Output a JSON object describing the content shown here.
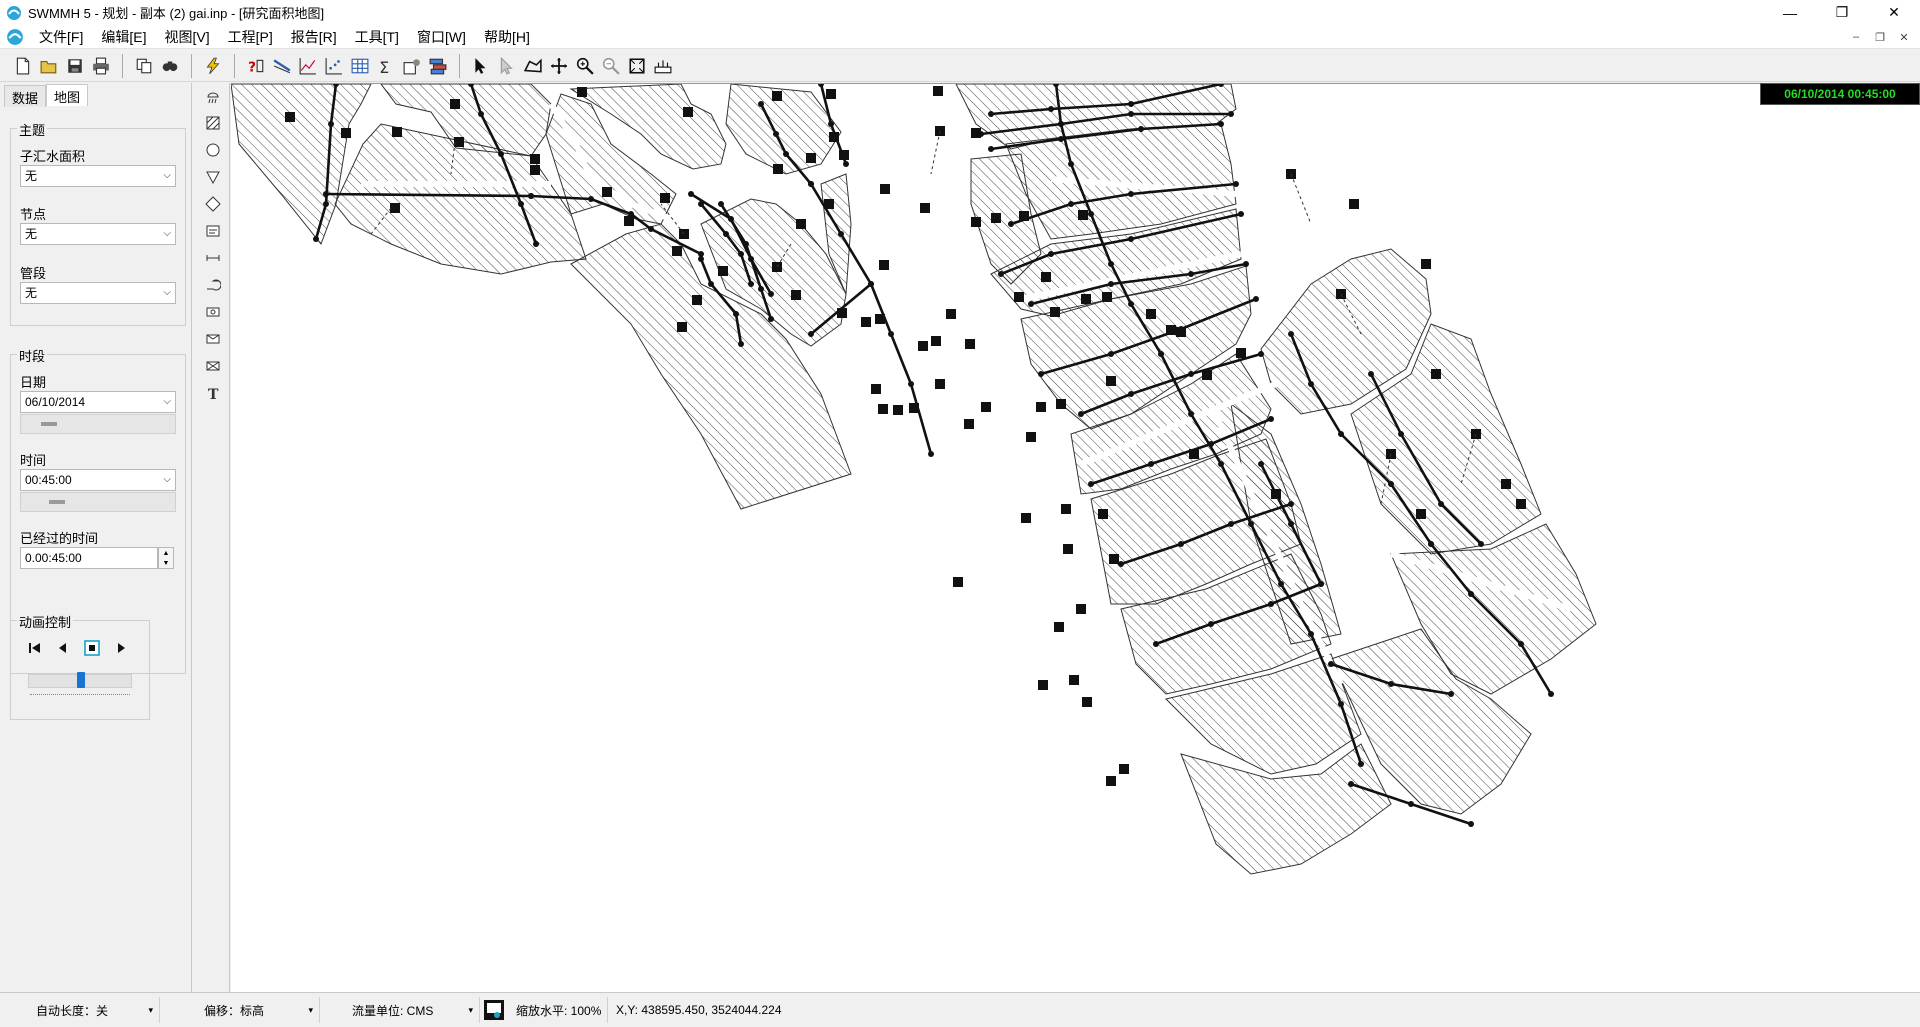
{
  "window": {
    "title": "SWMMH 5 - 规划 - 副本 (2) gai.inp - [研究面积地图]",
    "minimize": "—",
    "restore": "❐",
    "close": "✕"
  },
  "menu": {
    "items": [
      "文件[F]",
      "编辑[E]",
      "视图[V]",
      "工程[P]",
      "报告[R]",
      "工具[T]",
      "窗口[W]",
      "帮助[H]"
    ],
    "mdi_minimize": "–",
    "mdi_restore": "❐",
    "mdi_close": "✕"
  },
  "browser": {
    "tabs": [
      "数据",
      "地图"
    ],
    "active_tab": "地图",
    "theme_group": "主题",
    "subcatchment_label": "子汇水面积",
    "subcatchment_value": "无",
    "node_label": "节点",
    "node_value": "无",
    "link_label": "管段",
    "link_value": "无",
    "period_group": "时段",
    "date_label": "日期",
    "date_value": "06/10/2014",
    "time_label": "时间",
    "time_value": "00:45:00",
    "elapsed_label": "已经过的时间",
    "elapsed_value": "0.00:45:00",
    "animation_group": "动画控制",
    "animation_speed_fraction": 0.5
  },
  "map": {
    "clock": "06/10/2014 00:45:00"
  },
  "status": {
    "auto_length": "自动长度：关",
    "offset": "偏移：标高",
    "flow_units": "流量单位: CMS",
    "zoom": "缩放水平: 100%",
    "xy": "X,Y: 438595.450, 3524044.224"
  },
  "icons": {
    "toolbar": [
      "new-file-icon",
      "open-folder-icon",
      "save-icon",
      "print-icon",
      "copy-icon",
      "find-icon",
      "run-icon",
      "query-icon",
      "profile-plot-icon",
      "time-series-plot-icon",
      "scatter-plot-icon",
      "table-icon",
      "statistics-icon",
      "options-icon",
      "layers-icon",
      "select-arrow-icon",
      "select-vertex-icon",
      "select-region-icon",
      "pan-icon",
      "zoom-in-icon",
      "zoom-out-icon",
      "full-extent-icon",
      "measure-icon"
    ],
    "vertical": [
      "rain-gage-icon",
      "subcatchment-icon",
      "junction-icon",
      "outfall-icon",
      "divider-icon",
      "storage-icon",
      "conduit-icon",
      "pump-icon",
      "orifice-icon",
      "weir-icon",
      "outlet-icon",
      "label-text-icon"
    ]
  }
}
